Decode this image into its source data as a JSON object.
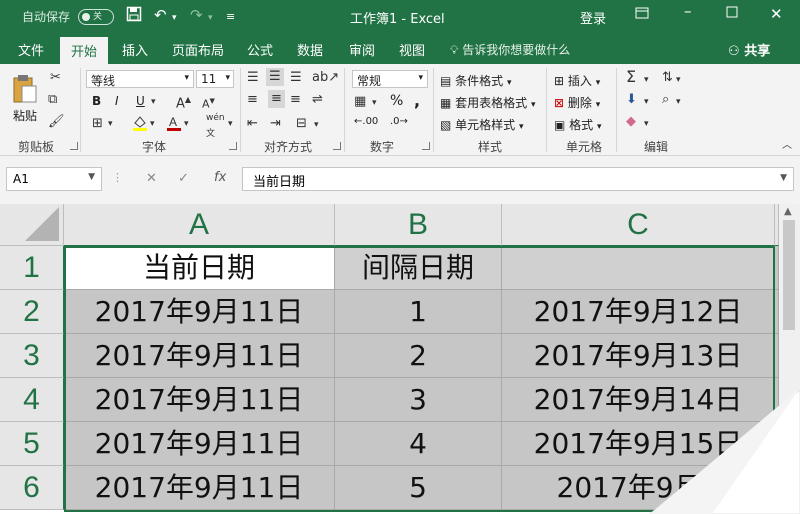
{
  "titlebar": {
    "autosave": "自动保存",
    "autosave_state": "关",
    "title": "工作簿1  -  Excel",
    "login": "登录"
  },
  "tabs": [
    "文件",
    "开始",
    "插入",
    "页面布局",
    "公式",
    "数据",
    "审阅",
    "视图"
  ],
  "tell_me": "告诉我你想要做什么",
  "share": "共享",
  "ribbon": {
    "paste": "粘贴",
    "font_name": "等线",
    "font_size": "11",
    "bold": "B",
    "italic": "I",
    "underline": "U",
    "wen": "wén",
    "number_format": "常规",
    "percent": "%",
    "comma": ",",
    "dec_inc": ".00",
    "dec_dec": ".0",
    "cond_format": "条件格式",
    "table_format": "套用表格格式",
    "cell_style": "单元格样式",
    "insert": "插入",
    "delete": "删除",
    "format": "格式",
    "groups": {
      "clipboard": "剪贴板",
      "font": "字体",
      "alignment": "对齐方式",
      "number": "数字",
      "styles": "样式",
      "cells": "单元格",
      "editing": "编辑"
    }
  },
  "formula_bar": {
    "name_box": "A1",
    "formula": "当前日期"
  },
  "grid": {
    "columns": [
      "A",
      "B",
      "C"
    ],
    "rows": [
      "1",
      "2",
      "3",
      "4",
      "5",
      "6"
    ],
    "cells": [
      [
        "当前日期",
        "间隔日期",
        ""
      ],
      [
        "2017年9月11日",
        "1",
        "2017年9月12日"
      ],
      [
        "2017年9月11日",
        "2",
        "2017年9月13日"
      ],
      [
        "2017年9月11日",
        "3",
        "2017年9月14日"
      ],
      [
        "2017年9月11日",
        "4",
        "2017年9月15日"
      ],
      [
        "2017年9月11日",
        "5",
        "2017年9月1"
      ]
    ]
  },
  "colors": {
    "brand": "#217346",
    "selection_fill": "#c6c6c6"
  }
}
